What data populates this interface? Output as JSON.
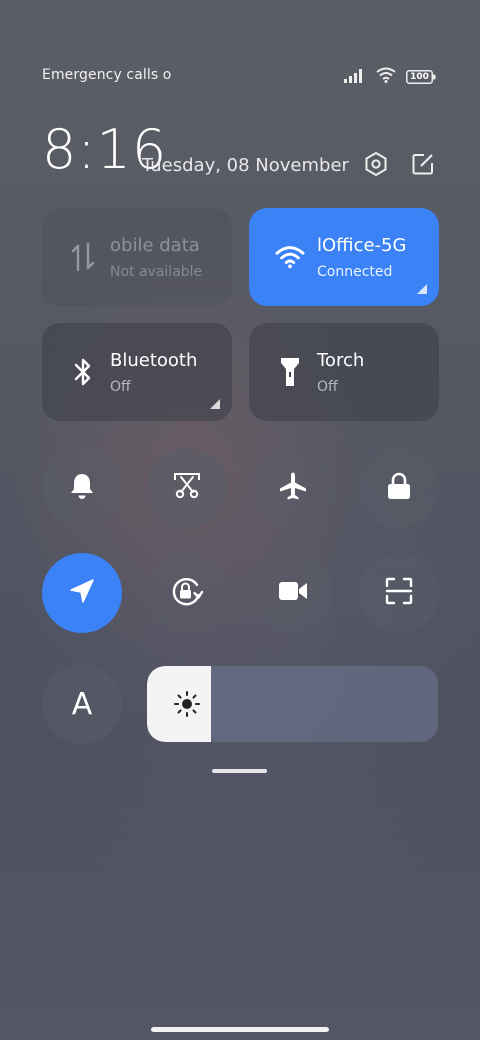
{
  "status_bar": {
    "carrier_text": "Emergency calls o",
    "battery": "100",
    "icons": [
      "signal-icon",
      "wifi-icon",
      "battery-icon"
    ]
  },
  "header": {
    "time": "8:16",
    "date": "Tuesday, 08 November",
    "icons": [
      "settings-icon",
      "edit-icon"
    ]
  },
  "tiles": [
    {
      "id": "mobile-data",
      "title": "obile data",
      "status": "Not available",
      "state": "disabled",
      "icon": "mobile-data-icon"
    },
    {
      "id": "wifi",
      "title": "lOffice-5G",
      "status": "Connected",
      "state": "on",
      "icon": "wifi-icon"
    },
    {
      "id": "bluetooth",
      "title": "Bluetooth",
      "status": "Off",
      "state": "off",
      "icon": "bluetooth-icon"
    },
    {
      "id": "torch",
      "title": "Torch",
      "status": "Off",
      "state": "off",
      "icon": "torch-icon"
    }
  ],
  "toggles": [
    {
      "id": "ringer",
      "icon": "bell-icon",
      "state": "off"
    },
    {
      "id": "screenshot",
      "icon": "scissors-icon",
      "state": "off"
    },
    {
      "id": "airplane",
      "icon": "airplane-icon",
      "state": "off"
    },
    {
      "id": "lock",
      "icon": "lock-icon",
      "state": "off"
    },
    {
      "id": "location",
      "icon": "location-arrow-icon",
      "state": "on"
    },
    {
      "id": "rotation-lock",
      "icon": "rotation-lock-icon",
      "state": "off"
    },
    {
      "id": "screen-recorder",
      "icon": "video-camera-icon",
      "state": "off"
    },
    {
      "id": "scanner",
      "icon": "scan-frame-icon",
      "state": "off"
    },
    {
      "id": "font-size",
      "icon": "letter-a-icon",
      "label": "A",
      "state": "off"
    }
  ],
  "brightness": {
    "level_fraction": 0.22,
    "icon": "sun-icon"
  },
  "colors": {
    "accent": "#3b82f6",
    "tile_bg": "#3c3e48"
  }
}
